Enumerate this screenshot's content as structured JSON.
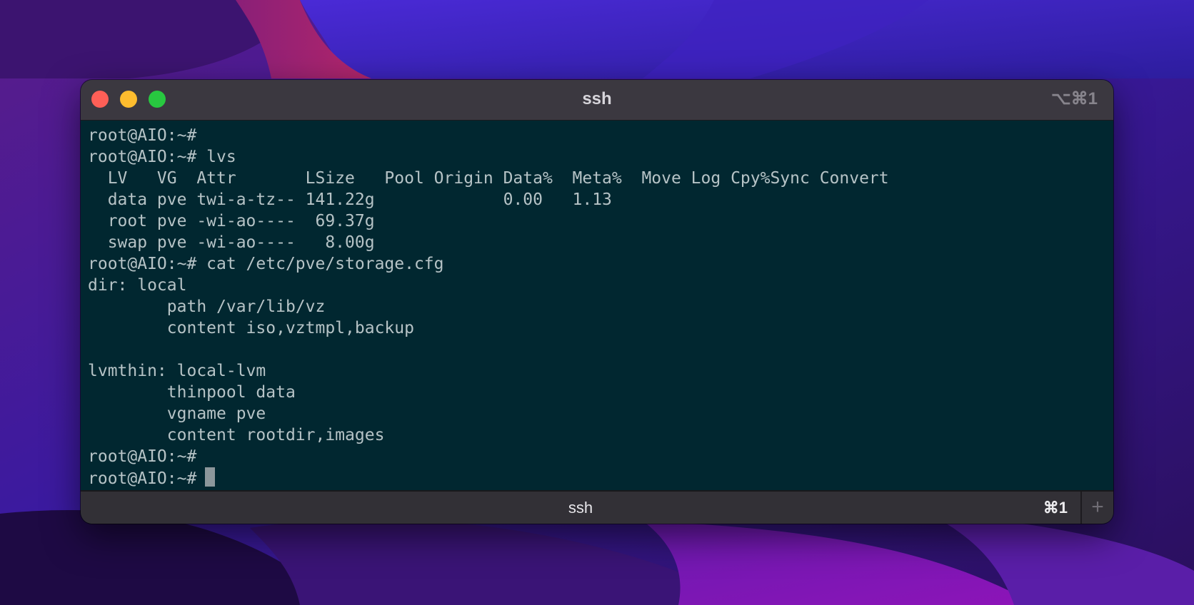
{
  "window": {
    "title": "ssh",
    "title_shortcut": "⌥⌘1"
  },
  "terminal": {
    "lines": [
      "root@AIO:~#",
      "root@AIO:~# lvs",
      "  LV   VG  Attr       LSize   Pool Origin Data%  Meta%  Move Log Cpy%Sync Convert",
      "  data pve twi-a-tz-- 141.22g             0.00   1.13",
      "  root pve -wi-ao----  69.37g",
      "  swap pve -wi-ao----   8.00g",
      "root@AIO:~# cat /etc/pve/storage.cfg",
      "dir: local",
      "        path /var/lib/vz",
      "        content iso,vztmpl,backup",
      "",
      "lvmthin: local-lvm",
      "        thinpool data",
      "        vgname pve",
      "        content rootdir,images",
      "root@AIO:~#"
    ],
    "prompt": "root@AIO:~# "
  },
  "tabs": [
    {
      "label": "ssh",
      "shortcut": "⌘1"
    }
  ],
  "new_tab_icon": "+",
  "colors": {
    "terminal_bg": "#012730",
    "terminal_fg": "#b6c3c6",
    "close": "#fe5f57",
    "minimize": "#febc2e",
    "maximize": "#28c840"
  }
}
